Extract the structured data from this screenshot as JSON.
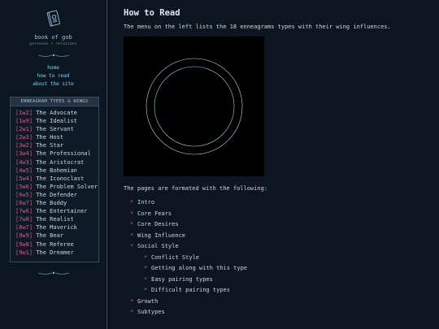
{
  "sidebar": {
    "logo_icon": "book-icon",
    "site_title": "book of gob",
    "site_subtitle": "personas • relations",
    "nav": [
      {
        "label": "home"
      },
      {
        "label": "how to read"
      },
      {
        "label": "about the site"
      }
    ],
    "types_header": "ENNEAGRAM TYPES & WINGS",
    "types": [
      {
        "code": "[1w2]",
        "name": "The Advocate"
      },
      {
        "code": "[1w9]",
        "name": "The Idealist"
      },
      {
        "code": "[2w1]",
        "name": "The Servant"
      },
      {
        "code": "[2w3]",
        "name": "The Host"
      },
      {
        "code": "[3w2]",
        "name": "The Star"
      },
      {
        "code": "[3w4]",
        "name": "The Professional"
      },
      {
        "code": "[4w3]",
        "name": "The Aristocrat"
      },
      {
        "code": "[4w5]",
        "name": "The Bohemian"
      },
      {
        "code": "[5w4]",
        "name": "The Iconoclast"
      },
      {
        "code": "[5w6]",
        "name": "The Problem Solver"
      },
      {
        "code": "[6w5]",
        "name": "The Defender"
      },
      {
        "code": "[6w7]",
        "name": "The Buddy"
      },
      {
        "code": "[7w6]",
        "name": "The Entertainer"
      },
      {
        "code": "[7w8]",
        "name": "The Realist"
      },
      {
        "code": "[8w7]",
        "name": "The Maverick"
      },
      {
        "code": "[8w9]",
        "name": "The Bear"
      },
      {
        "code": "[9w8]",
        "name": "The Referee"
      },
      {
        "code": "[9w1]",
        "name": "The Dreamer"
      }
    ]
  },
  "main": {
    "title": "How to Read",
    "intro": "The menu on the left lists the 18 enneagrams types with their wing influences.",
    "formatted_intro": "The pages are formated with the following:",
    "format_items": [
      {
        "label": "Intro",
        "sub": false
      },
      {
        "label": "Core Fears",
        "sub": false
      },
      {
        "label": "Core Desires",
        "sub": false
      },
      {
        "label": "Wing Influence",
        "sub": false
      },
      {
        "label": "Social Style",
        "sub": false
      },
      {
        "label": "Conflict Style",
        "sub": true
      },
      {
        "label": "Getting along with this type",
        "sub": true
      },
      {
        "label": "Easy pairing types",
        "sub": true
      },
      {
        "label": "Difficult pairing types",
        "sub": true
      },
      {
        "label": "Growth",
        "sub": false
      },
      {
        "label": "Subtypes",
        "sub": false
      }
    ]
  },
  "colors": {
    "background": "#0c1620",
    "accent_pink": "#cf5c8e",
    "link_cyan": "#7fd4ea"
  }
}
